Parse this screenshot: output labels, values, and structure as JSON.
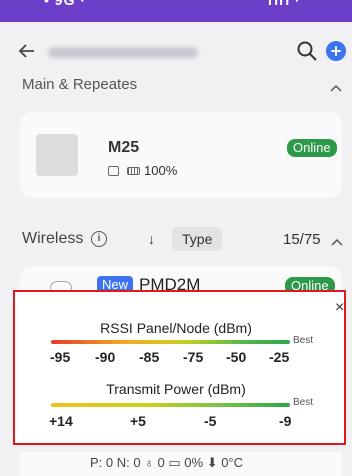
{
  "status_bar": {
    "time": "• 9G ·",
    "icons": "ПП ·"
  },
  "header": {
    "back_icon": "arrow-left-icon",
    "search_icon": "search-icon",
    "add_icon": "plus-circle-icon"
  },
  "main_section": {
    "title": "Main & Repeates",
    "device": {
      "name": "M25",
      "status": "Online",
      "battery": "100%"
    }
  },
  "wireless_section": {
    "title": "Wireless",
    "sort_icon": "↓",
    "type_button": "Type",
    "count": "15/75",
    "device": {
      "badge": "New",
      "name": "PMD2M",
      "status": "Online"
    },
    "bottom_row": "P: 0 N: 0  ♁ 0  ▭ 0%  ⬇ 0°C"
  },
  "legend_popup": {
    "close": "×",
    "rssi": {
      "title": "RSSI Panel/Node (dBm)",
      "best": "Best",
      "ticks": [
        "-95",
        "-90",
        "-85",
        "-75",
        "-50",
        "-25"
      ]
    },
    "transmit": {
      "title": "Transmit Power (dBm)",
      "best": "Best",
      "ticks": [
        "+14",
        "+5",
        "-5",
        "-9"
      ]
    }
  },
  "colors": {
    "accent": "#3c73f0",
    "online": "#2c9a49",
    "highlight_border": "#e0191e",
    "status_bar": "#6b3fc7"
  }
}
